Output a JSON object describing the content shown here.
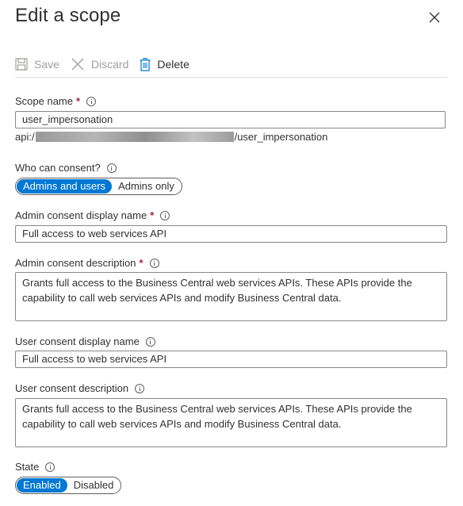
{
  "panel": {
    "title": "Edit a scope",
    "close_icon": "close-icon"
  },
  "toolbar": {
    "save_label": "Save",
    "discard_label": "Discard",
    "delete_label": "Delete"
  },
  "scope_name": {
    "label": "Scope name",
    "required": "*",
    "value": "user_impersonation",
    "uri_prefix": "api:/",
    "uri_suffix": "/user_impersonation"
  },
  "who_can_consent": {
    "label": "Who can consent?",
    "options": [
      "Admins and users",
      "Admins only"
    ],
    "selected": "Admins and users"
  },
  "admin_display_name": {
    "label": "Admin consent display name",
    "required": "*",
    "value": "Full access to web services API"
  },
  "admin_description": {
    "label": "Admin consent description",
    "required": "*",
    "value": "Grants full access to the Business Central web services APIs. These APIs provide the capability to call web services APIs and modify Business Central data."
  },
  "user_display_name": {
    "label": "User consent display name",
    "value": "Full access to web services API"
  },
  "user_description": {
    "label": "User consent description",
    "value": "Grants full access to the Business Central web services APIs. These APIs provide the capability to call web services APIs and modify Business Central data."
  },
  "state": {
    "label": "State",
    "options": [
      "Enabled",
      "Disabled"
    ],
    "selected": "Enabled"
  },
  "colors": {
    "accent": "#0078d4",
    "required": "#a4262c",
    "disabled_text": "#a19f9d"
  }
}
